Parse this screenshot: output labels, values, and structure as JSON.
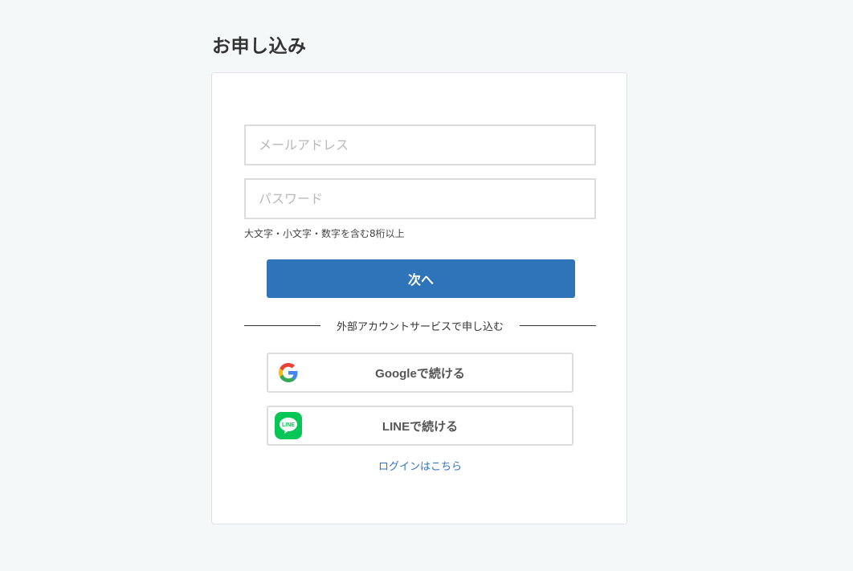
{
  "page": {
    "title": "お申し込み"
  },
  "form": {
    "email_placeholder": "メールアドレス",
    "email_value": "",
    "password_placeholder": "パスワード",
    "password_value": "",
    "password_hint": "大文字・小文字・数字を含む8桁以上",
    "next_label": "次へ"
  },
  "divider": {
    "label": "外部アカウントサービスで申し込む"
  },
  "social": {
    "google_label": "Googleで続ける",
    "google_icon": "google-icon",
    "line_label": "LINEで続ける",
    "line_icon": "line-icon",
    "line_icon_text": "LINE"
  },
  "login_link": "ログインはこちら",
  "colors": {
    "primary": "#2f74b8",
    "background": "#f5f8f8",
    "line_green": "#06c755"
  }
}
